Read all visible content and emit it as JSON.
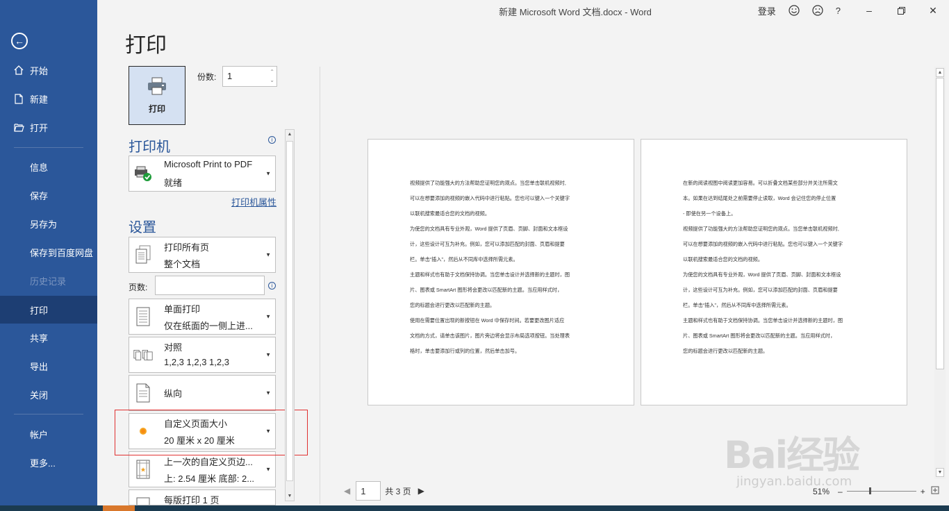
{
  "window": {
    "title": "新建 Microsoft Word 文档.docx  -  Word",
    "login": "登录",
    "help": "?"
  },
  "sidebar": {
    "items": [
      {
        "label": "开始"
      },
      {
        "label": "新建"
      },
      {
        "label": "打开"
      },
      {
        "label": "信息"
      },
      {
        "label": "保存"
      },
      {
        "label": "另存为"
      },
      {
        "label": "保存到百度网盘"
      },
      {
        "label": "历史记录"
      },
      {
        "label": "打印"
      },
      {
        "label": "共享"
      },
      {
        "label": "导出"
      },
      {
        "label": "关闭"
      },
      {
        "label": "帐户"
      },
      {
        "label": "更多..."
      }
    ]
  },
  "main": {
    "title": "打印",
    "print_button": "打印",
    "copies_label": "份数:",
    "copies_value": "1",
    "printer_heading": "打印机",
    "printer_name": "Microsoft Print to PDF",
    "printer_status": "就绪",
    "printer_properties": "打印机属性",
    "settings_heading": "设置",
    "settings": [
      {
        "line1": "打印所有页",
        "line2": "整个文档"
      },
      {
        "line1": "单面打印",
        "line2": "仅在纸面的一侧上进..."
      },
      {
        "line1": "对照",
        "line2": "1,2,3     1,2,3     1,2,3"
      },
      {
        "line1": "纵向",
        "line2": ""
      },
      {
        "line1": "自定义页面大小",
        "line2": "20 厘米 x 20 厘米"
      },
      {
        "line1": "上一次的自定义页边...",
        "line2": "上: 2.54 厘米 底部: 2..."
      },
      {
        "line1": "每版打印 1 页",
        "line2": ""
      }
    ],
    "pages_label": "页数:"
  },
  "preview": {
    "page1_lines": [
      "视频提供了功能强大的方法帮助您证明您的观点。当您单击联机视频时,",
      "可以在想要添加的视频的嵌入代码中进行粘贴。您也可以键入一个关键字",
      "以联机搜索最适合您的文档的视频。",
      "为使您的文档具有专业外观，Word 提供了页眉、页脚、封面和文本框设",
      "计，这些设计可互为补充。例如，您可以添加匹配的封面、页眉和提要",
      "栏。单击“插入”，然后从不同库中选择所需元素。",
      "主题和样式也有助于文档保持协调。当您单击设计并选择新的主题时，图",
      "片、图表或 SmartArt 图形将会更改以匹配新的主题。当应用样式时，",
      "您的标题会进行更改以匹配新的主题。",
      "使用在需要位置出现的新按钮在 Word 中保存时间。若要更改图片适应",
      "文档的方式，请单击该图片，图片旁边将会显示布局选项按钮。当处理表",
      "格时，单击要添加行或列的位置，然后单击加号。"
    ],
    "page2_lines": [
      "在新的阅读视图中阅读更加容易。可以折叠文档某些部分并关注所需文",
      "本。如果在达到结尾处之前需要停止读取，Word 会记住您的停止位置",
      "- 即使在另一个设备上。",
      "视频提供了功能强大的方法帮助您证明您的观点。当您单击联机视频时,",
      "可以在想要添加的视频的嵌入代码中进行粘贴。您也可以键入一个关键字",
      "以联机搜索最适合您的文档的视频。",
      "为使您的文档具有专业外观，Word 提供了页眉、页脚、封面和文本框设",
      "计，这些设计可互为补充。例如，您可以添加匹配的封面、页眉和提要",
      "栏。单击“插入”，然后从不同库中选择所需元素。",
      "主题和样式也有助于文档保持协调。当您单击设计并选择新的主题时，图",
      "片、图表或 SmartArt 图形将会更改以匹配新的主题。当应用样式时，",
      "您的标题会进行更改以匹配新的主题。"
    ],
    "current_page": "1",
    "total_pages": "共 3 页",
    "zoom": "51%"
  },
  "watermark": {
    "brand": "Bai经验",
    "url": "jingyan.baidu.com"
  }
}
